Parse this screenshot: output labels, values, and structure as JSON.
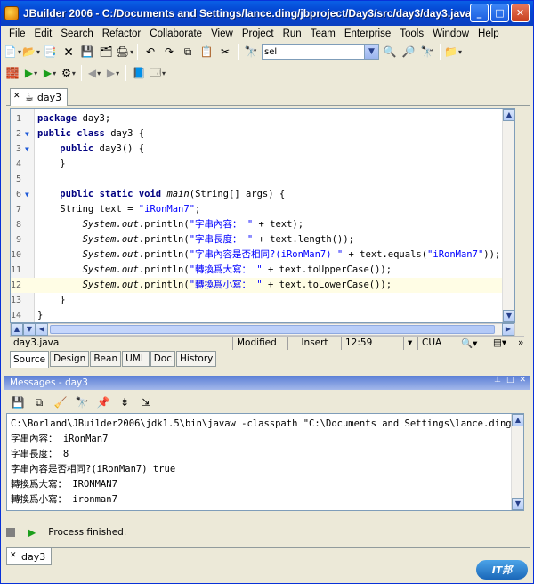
{
  "window": {
    "title": "JBuilder 2006 - C:/Documents and Settings/lance.ding/jbproject/Day3/src/day3/day3.java"
  },
  "menu": [
    "File",
    "Edit",
    "Search",
    "Refactor",
    "Collaborate",
    "View",
    "Project",
    "Run",
    "Team",
    "Enterprise",
    "Tools",
    "Window",
    "Help"
  ],
  "toolbar": {
    "search_value": "sel"
  },
  "editor": {
    "tab_label": "day3",
    "lines": [
      {
        "n": "1",
        "fold": "",
        "text": "package day3;"
      },
      {
        "n": "2",
        "fold": "▼",
        "text": "public class day3 {"
      },
      {
        "n": "3",
        "fold": "▼",
        "text": "    public day3() {"
      },
      {
        "n": "4",
        "fold": "",
        "text": "    }"
      },
      {
        "n": "5",
        "fold": "",
        "text": ""
      },
      {
        "n": "6",
        "fold": "▼",
        "text": "    public static void main(String[] args) {"
      },
      {
        "n": "7",
        "fold": "",
        "text": "    String text = \"iRonMan7\";"
      },
      {
        "n": "8",
        "fold": "",
        "text": "        System.out.println(\"字串內容： \" + text);"
      },
      {
        "n": "9",
        "fold": "",
        "text": "        System.out.println(\"字串長度： \" + text.length());"
      },
      {
        "n": "10",
        "fold": "",
        "text": "        System.out.println(\"字串內容是否相同?(iRonMan7) \" + text.equals(\"iRonMan7\"));"
      },
      {
        "n": "11",
        "fold": "",
        "text": "        System.out.println(\"轉換爲大寫： \" + text.toUpperCase());"
      },
      {
        "n": "12",
        "fold": "",
        "text": "        System.out.println(\"轉換爲小寫： \" + text.toLowerCase());"
      },
      {
        "n": "13",
        "fold": "",
        "text": "    }"
      },
      {
        "n": "14",
        "fold": "",
        "text": "}"
      }
    ]
  },
  "status": {
    "file": "day3.java",
    "modified": "Modified",
    "mode": "Insert",
    "position": "12:59",
    "keymap": "CUA"
  },
  "view_tabs": [
    "Source",
    "Design",
    "Bean",
    "UML",
    "Doc",
    "History"
  ],
  "messages": {
    "title": "Messages - day3",
    "lines": [
      "C:\\Borland\\JBuilder2006\\jdk1.5\\bin\\javaw -classpath \"C:\\Documents and Settings\\lance.ding\\",
      "字串內容： iRonMan7",
      "字串長度： 8",
      "字串內容是否相同?(iRonMan7) true",
      "轉換爲大寫： IRONMAN7",
      "轉換爲小寫： ironman7"
    ],
    "status": "Process finished.",
    "tab_label": "day3"
  },
  "badge": {
    "text": "IT邦"
  }
}
